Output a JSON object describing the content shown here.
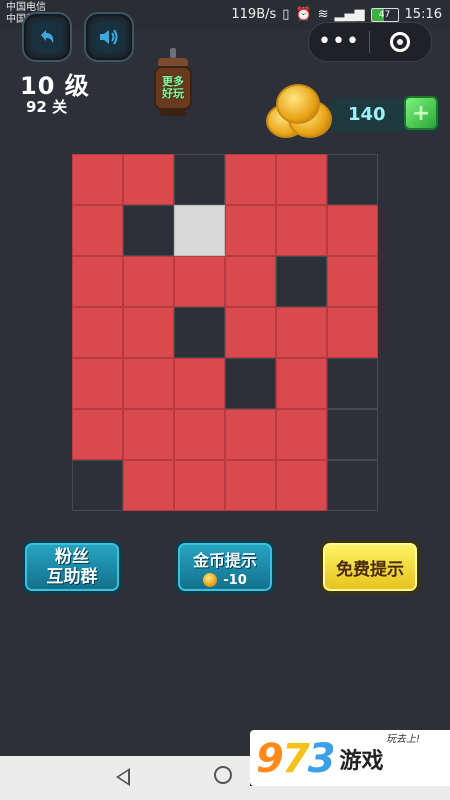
{
  "statusbar": {
    "carrier1": "中国电信",
    "carrier2": "中国移动",
    "speed": "119B/s",
    "battery": "47",
    "time": "15:16"
  },
  "header": {
    "back_icon": "undo-arrow-icon",
    "sound_icon": "speaker-icon",
    "menu_dots": "•••",
    "level_label": "10 级",
    "stage_label": "92 关",
    "more_games_line1": "更多",
    "more_games_line2": "好玩",
    "coins": "140"
  },
  "board": {
    "cols": 6,
    "rows": 7,
    "filled_color": "#d94a4f",
    "cells": [
      [
        1,
        1,
        0,
        1,
        1,
        0
      ],
      [
        1,
        0,
        2,
        1,
        1,
        1
      ],
      [
        1,
        1,
        1,
        1,
        0,
        1
      ],
      [
        1,
        1,
        0,
        1,
        1,
        1
      ],
      [
        1,
        1,
        1,
        0,
        1,
        0
      ],
      [
        1,
        1,
        1,
        1,
        1,
        0
      ],
      [
        0,
        1,
        1,
        1,
        1,
        0
      ]
    ]
  },
  "buttons": {
    "fans_line1": "粉丝",
    "fans_line2": "互助群",
    "coin_hint": "金币提示",
    "coin_hint_cost": "-10",
    "free_hint": "免费提示"
  },
  "watermark": {
    "d1": "9",
    "d2": "7",
    "d3": "3",
    "word": "游戏",
    "tag": "玩去上!"
  }
}
